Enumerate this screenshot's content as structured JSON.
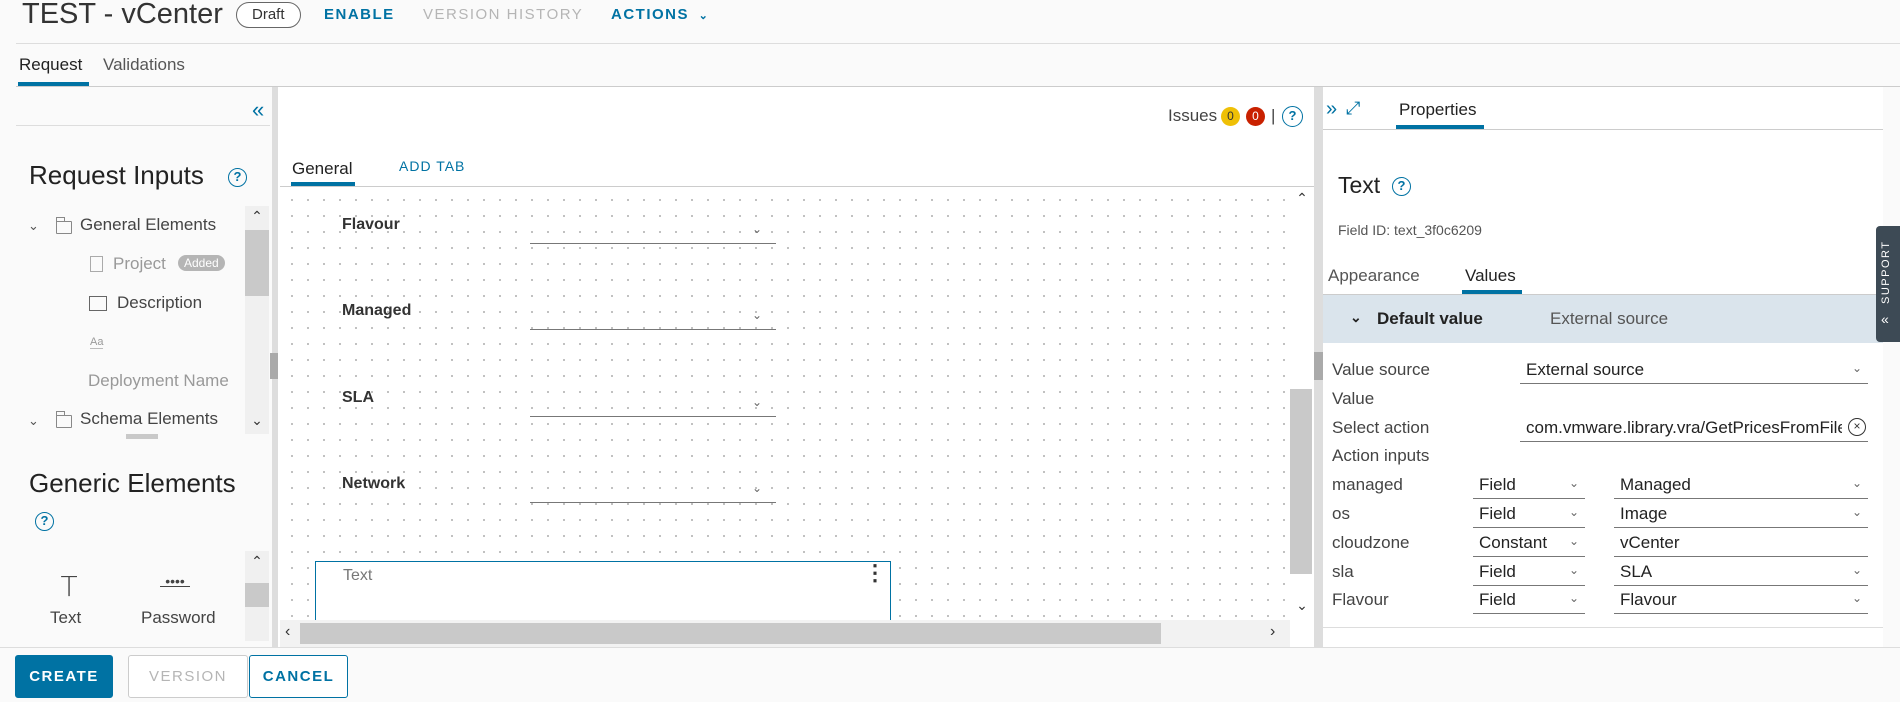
{
  "header": {
    "title": "TEST - vCenter",
    "status_badge": "Draft",
    "links": {
      "enable": "ENABLE",
      "version_history": "VERSION HISTORY",
      "actions": "ACTIONS"
    }
  },
  "main_tabs": [
    {
      "label": "Request"
    },
    {
      "label": "Validations"
    }
  ],
  "left_panel": {
    "request_inputs": {
      "title": "Request Inputs",
      "help": "?",
      "tree": [
        {
          "label": "General Elements"
        },
        {
          "label": "Project",
          "badge": "Added"
        },
        {
          "label": "Description"
        },
        {
          "label": "Aa"
        },
        {
          "label": "Deployment Name"
        },
        {
          "label": "Schema Elements"
        }
      ]
    },
    "generic_elements": {
      "title": "Generic Elements",
      "help": "?",
      "items": [
        {
          "label": "Text",
          "icon_glyph": "T"
        },
        {
          "label": "Password",
          "icon_glyph": "••••"
        }
      ]
    }
  },
  "canvas": {
    "issues_label": "Issues",
    "issues_warning_count": "0",
    "issues_error_count": "0",
    "issues_sep": "|",
    "help": "?",
    "tabs": [
      {
        "label": "General"
      },
      {
        "label": "ADD TAB"
      }
    ],
    "fields": [
      {
        "label": "Flavour"
      },
      {
        "label": "Managed"
      },
      {
        "label": "SLA"
      },
      {
        "label": "Network"
      }
    ],
    "text_card": {
      "label": "Text",
      "menu": "⋮"
    }
  },
  "properties": {
    "tab_label": "Properties",
    "title": "Text",
    "help": "?",
    "field_id": "Field ID: text_3f0c6209",
    "sub_tabs": [
      {
        "label": "Appearance"
      },
      {
        "label": "Values"
      }
    ],
    "default_value": {
      "title": "Default value",
      "summary": "External source",
      "value_source_label": "Value source",
      "value_source": "External source",
      "value_label": "Value",
      "select_action_label": "Select action",
      "select_action": "com.vmware.library.vra/GetPricesFromFile",
      "action_inputs_label": "Action inputs",
      "action_inputs": [
        {
          "name": "managed",
          "type": "Field",
          "value": "Managed"
        },
        {
          "name": "os",
          "type": "Field",
          "value": "Image"
        },
        {
          "name": "cloudzone",
          "type": "Constant",
          "value": "vCenter"
        },
        {
          "name": "sla",
          "type": "Field",
          "value": "SLA"
        },
        {
          "name": "Flavour",
          "type": "Field",
          "value": "Flavour"
        }
      ]
    }
  },
  "support": {
    "label": "SUPPORT"
  },
  "footer": {
    "create": "CREATE",
    "version": "VERSION",
    "cancel": "CANCEL"
  },
  "colors": {
    "accent": "#0072a3",
    "warning": "#efc006",
    "error": "#c92100"
  }
}
